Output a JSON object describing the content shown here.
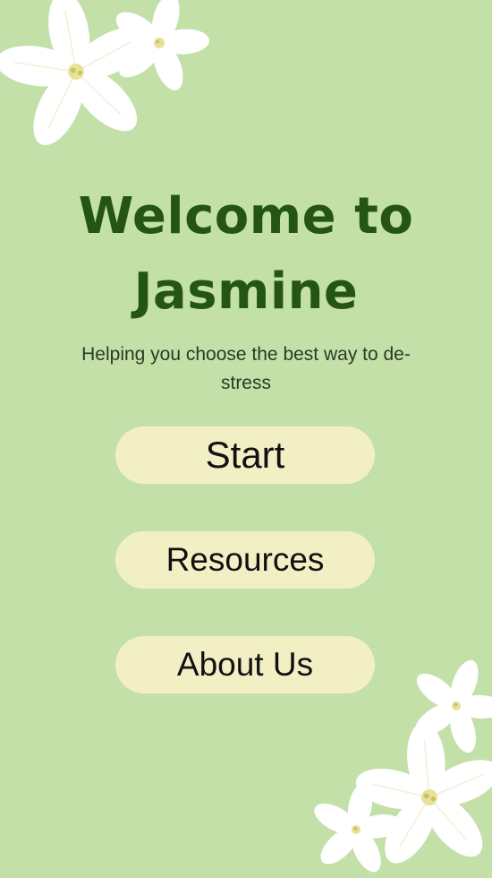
{
  "app": {
    "title_line1": "Welcome to",
    "title_line2": "Jasmine",
    "subtitle": "Helping you choose the best way to de-stress"
  },
  "buttons": {
    "start": "Start",
    "resources": "Resources",
    "about": "About Us"
  },
  "colors": {
    "background": "#c3e0a9",
    "title": "#245512",
    "button_fill": "#f3efc5",
    "flower_petal": "#ffffff",
    "flower_center": "#e6e29a"
  },
  "decorations": {
    "flowers": "jasmine-flower-icon"
  }
}
